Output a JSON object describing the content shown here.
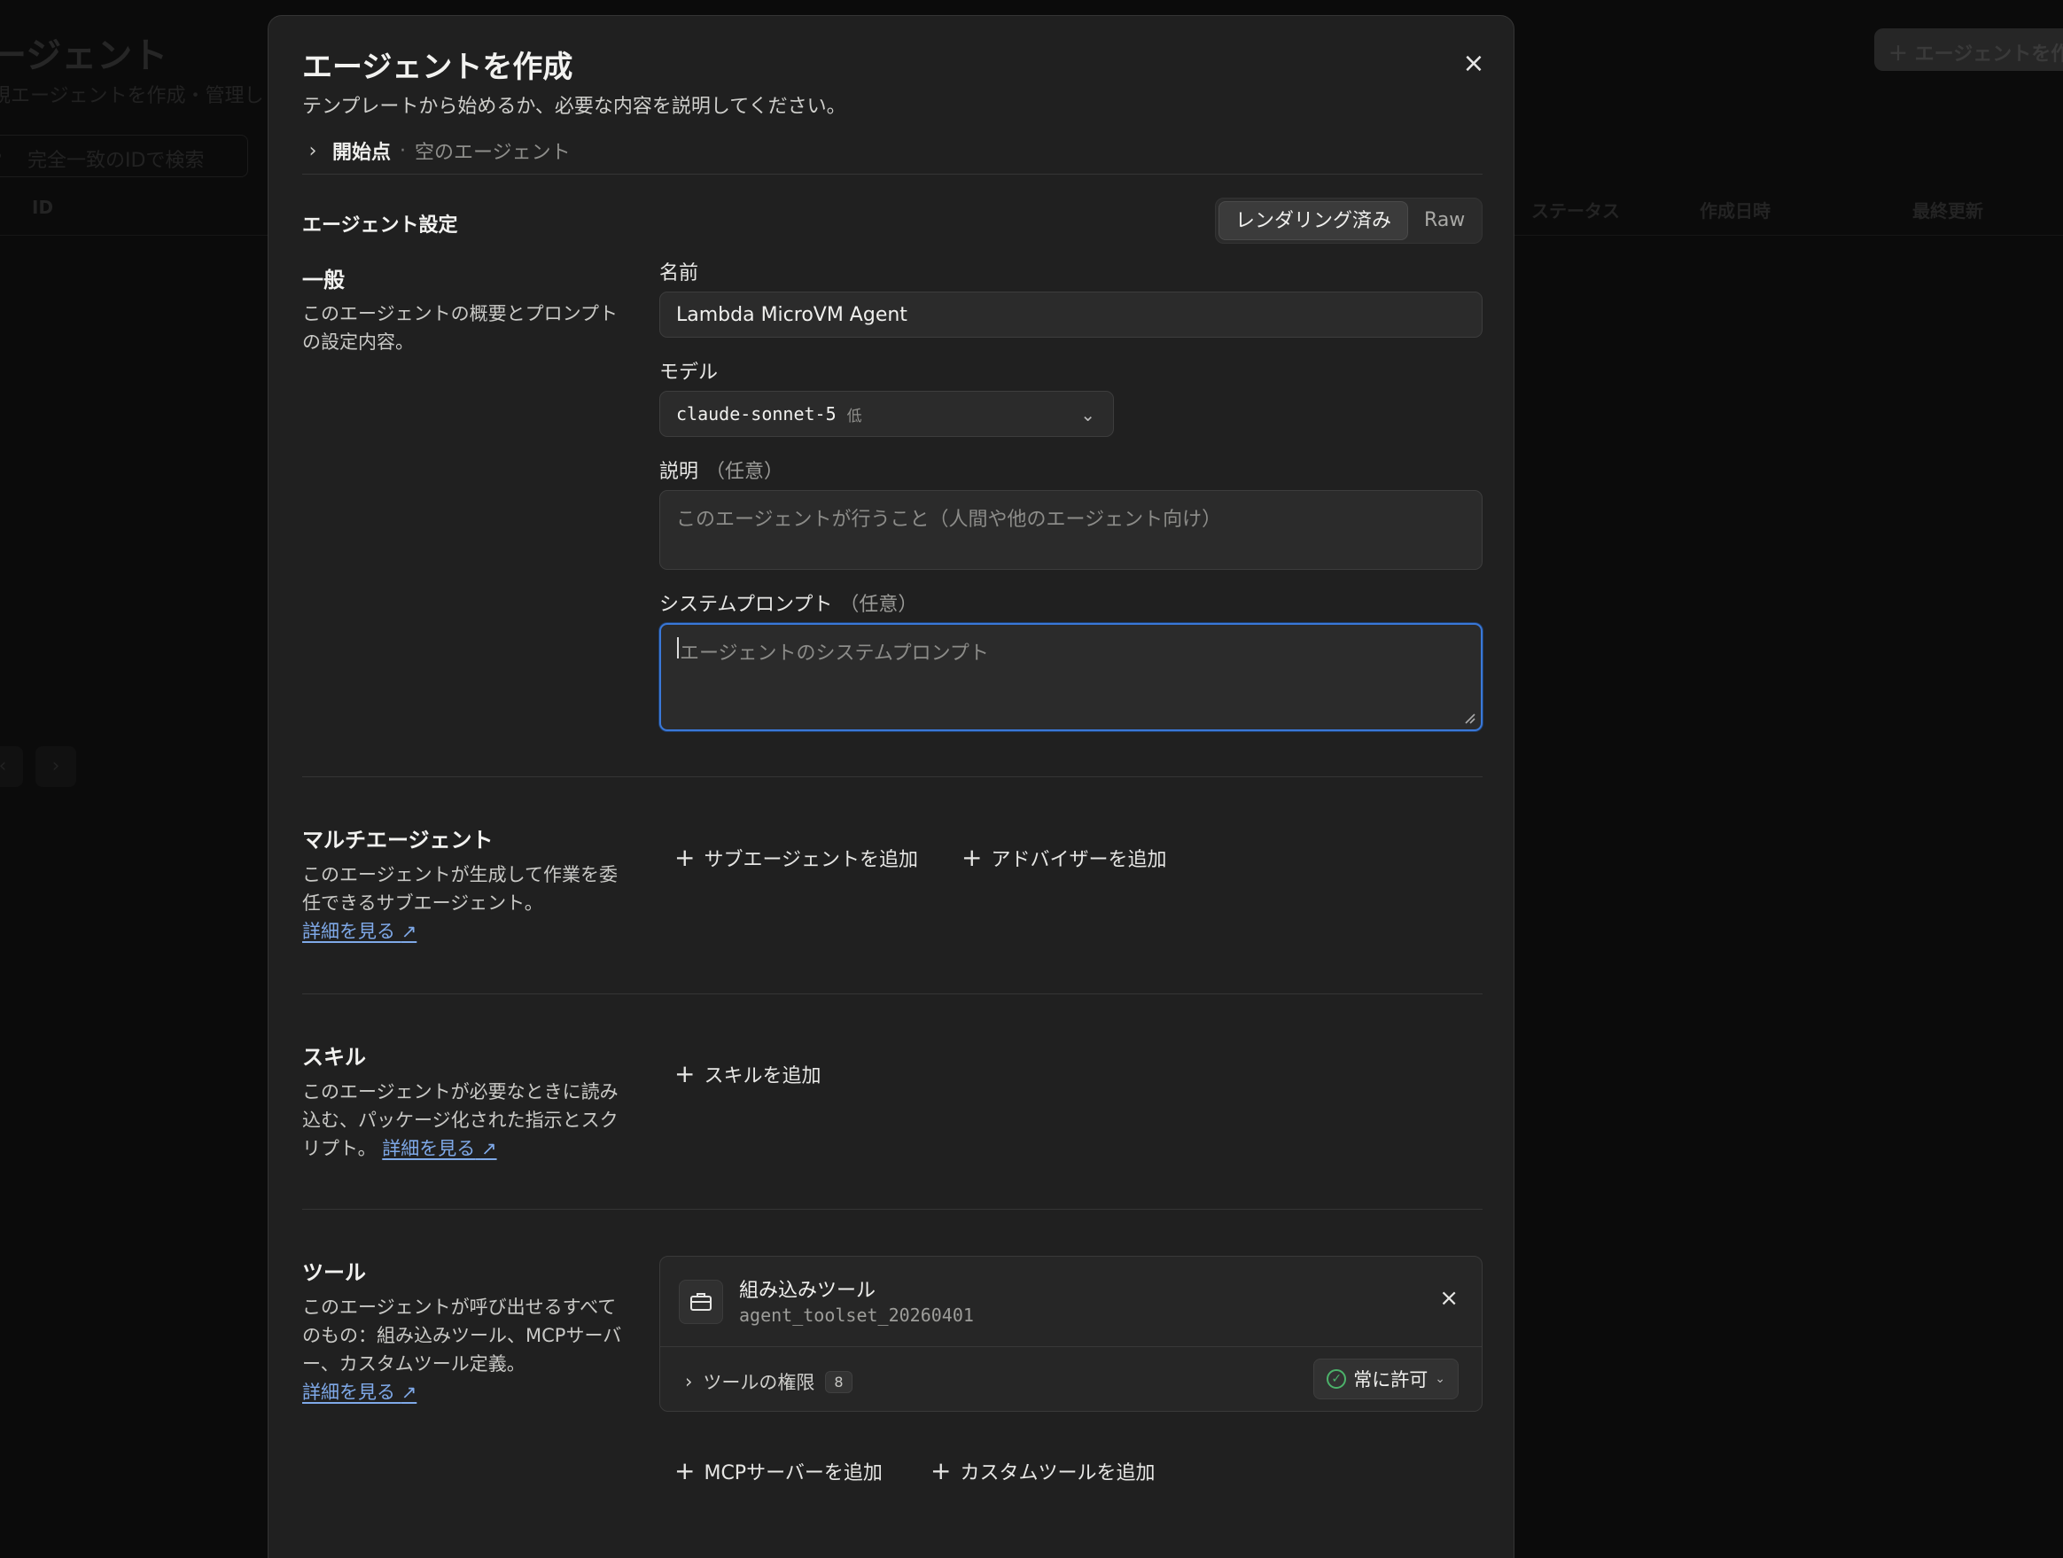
{
  "background": {
    "title": "ージェント",
    "subtitle": "規エージェントを作成・管理し",
    "search_placeholder": "完全一致のIDで検索",
    "columns": [
      "ID",
      "ステータス",
      "作成日時",
      "最終更新"
    ],
    "new_button": "エージェントを作"
  },
  "modal": {
    "title": "エージェントを作成",
    "subtitle": "テンプレートから始めるか、必要な内容を説明してください。",
    "close_icon": "×",
    "breadcrumb": {
      "label": "開始点",
      "separator": "·",
      "value": "空のエージェント"
    }
  },
  "settings": {
    "heading": "エージェント設定",
    "view_toggle": {
      "rendered": "レンダリング済み",
      "raw": "Raw",
      "active": "rendered"
    }
  },
  "general": {
    "title": "一般",
    "description": "このエージェントの概要とプロンプトの設定内容。",
    "name_label": "名前",
    "name_value": "Lambda MicroVM Agent",
    "model_label": "モデル",
    "model_value": "claude-sonnet-5",
    "model_tag": "低",
    "description_label": "説明",
    "optional": "（任意）",
    "description_placeholder": "このエージェントが行うこと（人間や他のエージェント向け）",
    "system_prompt_label": "システムプロンプト",
    "system_prompt_placeholder": "エージェントのシステムプロンプト"
  },
  "multi_agent": {
    "title": "マルチエージェント",
    "description": "このエージェントが生成して作業を委任できるサブエージェント。",
    "learn_more": "詳細を見る",
    "add_subagent": "サブエージェントを追加",
    "add_advisor": "アドバイザーを追加"
  },
  "skills": {
    "title": "スキル",
    "description": "このエージェントが必要なときに読み込む、パッケージ化された指示とスクリプト。",
    "learn_more": "詳細を見る",
    "add_skill": "スキルを追加"
  },
  "tools": {
    "title": "ツール",
    "description": "このエージェントが呼び出せるすべてのもの：組み込みツール、MCPサーバー、カスタムツール定義。",
    "learn_more": "詳細を見る",
    "card": {
      "name": "組み込みツール",
      "id": "agent_toolset_20260401",
      "permissions_label": "ツールの権限",
      "permissions_count": "8",
      "policy": "常に許可"
    },
    "add_mcp": "MCPサーバーを追加",
    "add_custom": "カスタムツールを追加"
  },
  "icons": {
    "close": "close-icon",
    "chevron_right": "chevron-right-icon",
    "chevron_down": "chevron-down-icon",
    "plus": "plus-icon",
    "external_link": "arrow-up-right-icon",
    "toolbox": "briefcase-icon",
    "check": "check-circle-icon"
  },
  "colors": {
    "accent_focus": "#3a78d8",
    "link": "#7fa9e8",
    "success": "#4cb26a",
    "modal_bg": "#202020"
  }
}
